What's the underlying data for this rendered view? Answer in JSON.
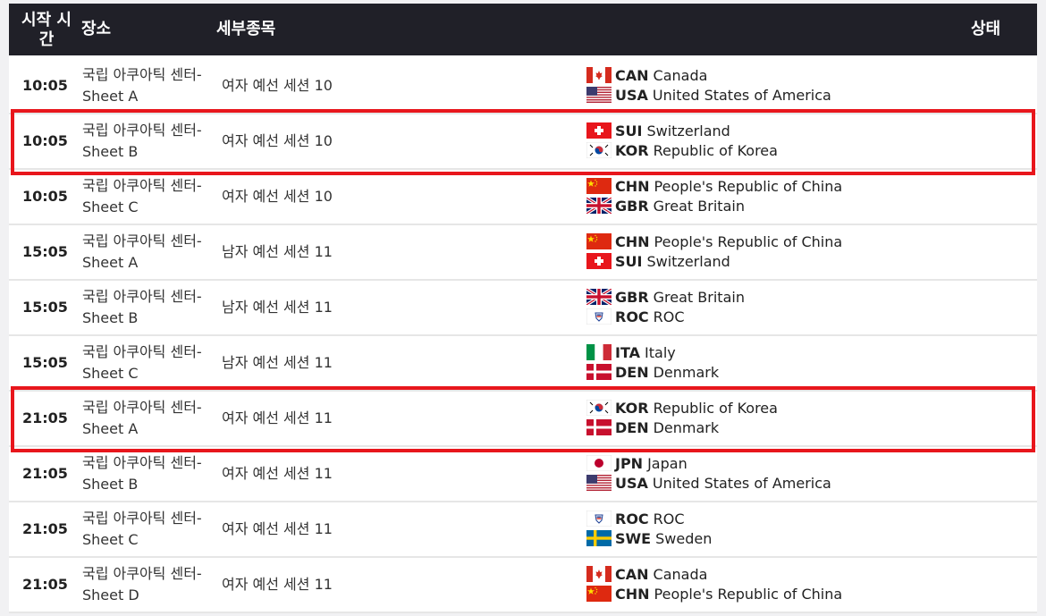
{
  "header": {
    "time": "시작 시간",
    "venue": "장소",
    "event": "세부종목",
    "status": "상태"
  },
  "rows": [
    {
      "time": "10:05",
      "venue": "국립 아쿠아틱 센터-Sheet A",
      "event": "여자 예선 세션 10",
      "teams": [
        {
          "flag": "CAN",
          "code": "CAN",
          "name": "Canada"
        },
        {
          "flag": "USA",
          "code": "USA",
          "name": "United States of America"
        }
      ]
    },
    {
      "time": "10:05",
      "venue": "국립 아쿠아틱 센터-Sheet B",
      "event": "여자 예선 세션 10",
      "teams": [
        {
          "flag": "SUI",
          "code": "SUI",
          "name": "Switzerland"
        },
        {
          "flag": "KOR",
          "code": "KOR",
          "name": "Republic of Korea"
        }
      ]
    },
    {
      "time": "10:05",
      "venue": "국립 아쿠아틱 센터-Sheet C",
      "event": "여자 예선 세션 10",
      "teams": [
        {
          "flag": "CHN",
          "code": "CHN",
          "name": "People's Republic of China"
        },
        {
          "flag": "GBR",
          "code": "GBR",
          "name": "Great Britain"
        }
      ]
    },
    {
      "time": "15:05",
      "venue": "국립 아쿠아틱 센터-Sheet A",
      "event": "남자 예선 세션 11",
      "teams": [
        {
          "flag": "CHN",
          "code": "CHN",
          "name": "People's Republic of China"
        },
        {
          "flag": "SUI",
          "code": "SUI",
          "name": "Switzerland"
        }
      ]
    },
    {
      "time": "15:05",
      "venue": "국립 아쿠아틱 센터-Sheet B",
      "event": "남자 예선 세션 11",
      "teams": [
        {
          "flag": "GBR",
          "code": "GBR",
          "name": "Great Britain"
        },
        {
          "flag": "ROC",
          "code": "ROC",
          "name": "ROC"
        }
      ]
    },
    {
      "time": "15:05",
      "venue": "국립 아쿠아틱 센터-Sheet C",
      "event": "남자 예선 세션 11",
      "teams": [
        {
          "flag": "ITA",
          "code": "ITA",
          "name": "Italy"
        },
        {
          "flag": "DEN",
          "code": "DEN",
          "name": "Denmark"
        }
      ]
    },
    {
      "time": "21:05",
      "venue": "국립 아쿠아틱 센터-Sheet A",
      "event": "여자 예선 세션 11",
      "teams": [
        {
          "flag": "KOR",
          "code": "KOR",
          "name": "Republic of Korea"
        },
        {
          "flag": "DEN",
          "code": "DEN",
          "name": "Denmark"
        }
      ]
    },
    {
      "time": "21:05",
      "venue": "국립 아쿠아틱 센터-Sheet B",
      "event": "여자 예선 세션 11",
      "teams": [
        {
          "flag": "JPN",
          "code": "JPN",
          "name": "Japan"
        },
        {
          "flag": "USA",
          "code": "USA",
          "name": "United States of America"
        }
      ]
    },
    {
      "time": "21:05",
      "venue": "국립 아쿠아틱 센터-Sheet C",
      "event": "여자 예선 세션 11",
      "teams": [
        {
          "flag": "ROC",
          "code": "ROC",
          "name": "ROC"
        },
        {
          "flag": "SWE",
          "code": "SWE",
          "name": "Sweden"
        }
      ]
    },
    {
      "time": "21:05",
      "venue": "국립 아쿠아틱 센터-Sheet D",
      "event": "여자 예선 세션 11",
      "teams": [
        {
          "flag": "CAN",
          "code": "CAN",
          "name": "Canada"
        },
        {
          "flag": "CHN",
          "code": "CHN",
          "name": "People's Republic of China"
        }
      ]
    }
  ],
  "highlighted_rows": [
    1,
    6
  ],
  "colors": {
    "header_bg": "#202028",
    "highlight": "#e8161c"
  }
}
